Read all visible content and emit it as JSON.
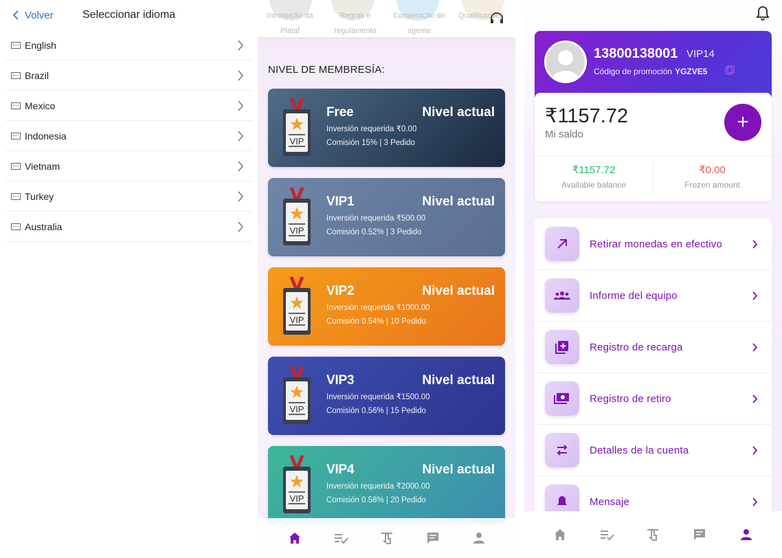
{
  "language_panel": {
    "back_label": "Volver",
    "title": "Seleccionar idioma",
    "languages": [
      "English",
      "Brazil",
      "Mexico",
      "Indonesia",
      "Vietnam",
      "Turkey",
      "Australia"
    ]
  },
  "vip_panel": {
    "top_links": [
      "Introdução da Plataf",
      "Regras e regulamento",
      "Cooperação de agente",
      "Qualificações"
    ],
    "section_title": "NIVEL DE MEMBRESÍA:",
    "cards": [
      {
        "name": "Free",
        "status": "Nivel actual",
        "investment": "Inversión requerida ₹0.00",
        "commission": "Comisión 15% | 3 Pedido",
        "color_from": "#4f6d8a",
        "color_to": "#1a2940"
      },
      {
        "name": "VIP1",
        "status": "Nivel actual",
        "investment": "Inversión requerida ₹500.00",
        "commission": "Comisión 0.52% | 3 Pedido",
        "color_from": "#6f86a8",
        "color_to": "#5a6e92"
      },
      {
        "name": "VIP2",
        "status": "Nivel actual",
        "investment": "Inversión requerida ₹1000.00",
        "commission": "Comisión 0.54% | 10 Pedido",
        "color_from": "#f59c1a",
        "color_to": "#e8751c"
      },
      {
        "name": "VIP3",
        "status": "Nivel actual",
        "investment": "Inversión requerida ₹1500.00",
        "commission": "Comisión 0.56% | 15 Pedido",
        "color_from": "#3f4fb0",
        "color_to": "#2c348f"
      },
      {
        "name": "VIP4",
        "status": "Nivel actual",
        "investment": "Inversión requerida ₹2000.00",
        "commission": "Comisión 0.58% | 20 Pedido",
        "color_from": "#3fb59a",
        "color_to": "#3c8db0"
      }
    ],
    "badge_text": "VIP",
    "tab_active_color": "#7e12b8"
  },
  "account_panel": {
    "phone": "13800138001",
    "vip_level": "VIP14",
    "promo_label": "Código de promoción",
    "promo_code": "YGZVE5",
    "balance": "₹1157.72",
    "balance_label": "Mi saldo",
    "plus_label": "+",
    "available_value": "₹1157.72",
    "available_label": "Available balance",
    "frozen_value": "₹0.00",
    "frozen_label": "Frozen amount",
    "menu": [
      {
        "label": "Retirar monedas en efectivo",
        "icon": "arrow-up-right-icon"
      },
      {
        "label": "Informe del equipo",
        "icon": "team-icon"
      },
      {
        "label": "Registro de recarga",
        "icon": "recharge-icon"
      },
      {
        "label": "Registro de retiro",
        "icon": "withdraw-icon"
      },
      {
        "label": "Detalles de la cuenta",
        "icon": "swap-icon"
      },
      {
        "label": "Mensaje",
        "icon": "bell-icon"
      }
    ],
    "brand_color": "#7e12b8"
  }
}
